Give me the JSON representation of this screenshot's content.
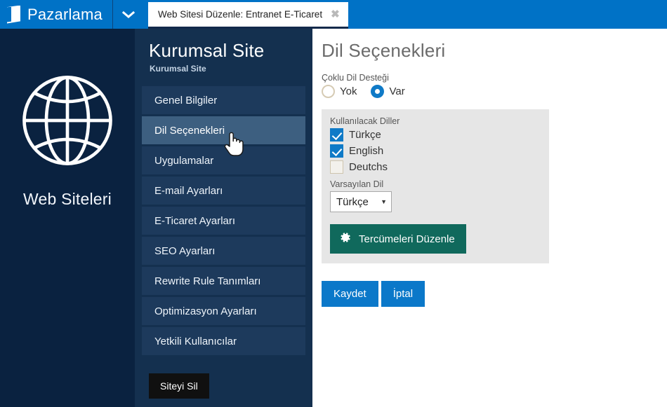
{
  "topbar": {
    "brand_label": "Pazarlama",
    "brand_icon": "page-icon",
    "dropdown_icon": "chevron-down-icon",
    "tabs": [
      {
        "label": "Web Sitesi Düzenle: Entranet E-Ticaret",
        "close_icon": "close-icon",
        "active": true
      }
    ],
    "bg_color": "#0072c6"
  },
  "leftpanel": {
    "icon": "globe-icon",
    "label": "Web Siteleri",
    "bg_color": "#0a2240"
  },
  "sidebar": {
    "title": "Kurumsal Site",
    "subtitle": "Kurumsal Site",
    "items": [
      {
        "label": "Genel Bilgiler",
        "active": false
      },
      {
        "label": "Dil Seçenekleri",
        "active": true
      },
      {
        "label": "Uygulamalar",
        "active": false
      },
      {
        "label": "E-mail Ayarları",
        "active": false
      },
      {
        "label": "E-Ticaret Ayarları",
        "active": false
      },
      {
        "label": "SEO Ayarları",
        "active": false
      },
      {
        "label": "Rewrite Rule Tanımları",
        "active": false
      },
      {
        "label": "Optimizasyon Ayarları",
        "active": false
      },
      {
        "label": "Yetkili Kullanıcılar",
        "active": false
      }
    ],
    "delete_button": "Siteyi Sil",
    "bg_color": "#14304f",
    "active_color": "#3d5f80"
  },
  "content": {
    "page_title": "Dil Seçenekleri",
    "multilang": {
      "label": "Çoklu Dil Desteği",
      "options": [
        {
          "label": "Yok",
          "checked": false
        },
        {
          "label": "Var",
          "checked": true
        }
      ]
    },
    "languages": {
      "label": "Kullanılacak Diller",
      "items": [
        {
          "label": "Türkçe",
          "checked": true
        },
        {
          "label": "English",
          "checked": true
        },
        {
          "label": "Deutchs",
          "checked": false
        }
      ]
    },
    "default_language": {
      "label": "Varsayılan Dil",
      "value": "Türkçe",
      "arrow_icon": "triangle-down-icon"
    },
    "translate_button": {
      "label": "Tercümeleri Düzenle",
      "icon": "gear-icon",
      "color": "#10695c"
    },
    "actions": [
      {
        "label": "Kaydet"
      },
      {
        "label": "İptal"
      }
    ],
    "accent_color": "#0b78c9"
  },
  "cursor": {
    "icon": "pointing-hand-cursor"
  }
}
